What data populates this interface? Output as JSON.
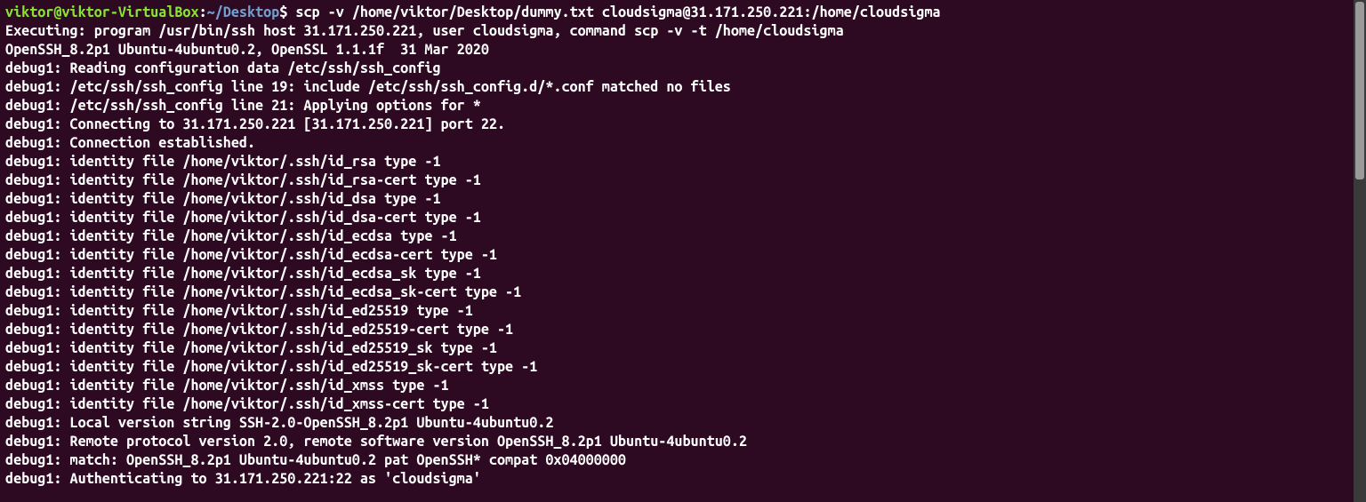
{
  "prompt": {
    "user_host": "viktor@viktor-VirtualBox",
    "colon": ":",
    "path": "~/Desktop",
    "dollar": "$",
    "command": " scp -v /home/viktor/Desktop/dummy.txt cloudsigma@31.171.250.221:/home/cloudsigma"
  },
  "lines": [
    "Executing: program /usr/bin/ssh host 31.171.250.221, user cloudsigma, command scp -v -t /home/cloudsigma",
    "OpenSSH_8.2p1 Ubuntu-4ubuntu0.2, OpenSSL 1.1.1f  31 Mar 2020",
    "debug1: Reading configuration data /etc/ssh/ssh_config",
    "debug1: /etc/ssh/ssh_config line 19: include /etc/ssh/ssh_config.d/*.conf matched no files",
    "debug1: /etc/ssh/ssh_config line 21: Applying options for *",
    "debug1: Connecting to 31.171.250.221 [31.171.250.221] port 22.",
    "debug1: Connection established.",
    "debug1: identity file /home/viktor/.ssh/id_rsa type -1",
    "debug1: identity file /home/viktor/.ssh/id_rsa-cert type -1",
    "debug1: identity file /home/viktor/.ssh/id_dsa type -1",
    "debug1: identity file /home/viktor/.ssh/id_dsa-cert type -1",
    "debug1: identity file /home/viktor/.ssh/id_ecdsa type -1",
    "debug1: identity file /home/viktor/.ssh/id_ecdsa-cert type -1",
    "debug1: identity file /home/viktor/.ssh/id_ecdsa_sk type -1",
    "debug1: identity file /home/viktor/.ssh/id_ecdsa_sk-cert type -1",
    "debug1: identity file /home/viktor/.ssh/id_ed25519 type -1",
    "debug1: identity file /home/viktor/.ssh/id_ed25519-cert type -1",
    "debug1: identity file /home/viktor/.ssh/id_ed25519_sk type -1",
    "debug1: identity file /home/viktor/.ssh/id_ed25519_sk-cert type -1",
    "debug1: identity file /home/viktor/.ssh/id_xmss type -1",
    "debug1: identity file /home/viktor/.ssh/id_xmss-cert type -1",
    "debug1: Local version string SSH-2.0-OpenSSH_8.2p1 Ubuntu-4ubuntu0.2",
    "debug1: Remote protocol version 2.0, remote software version OpenSSH_8.2p1 Ubuntu-4ubuntu0.2",
    "debug1: match: OpenSSH_8.2p1 Ubuntu-4ubuntu0.2 pat OpenSSH* compat 0x04000000",
    "debug1: Authenticating to 31.171.250.221:22 as 'cloudsigma'"
  ]
}
